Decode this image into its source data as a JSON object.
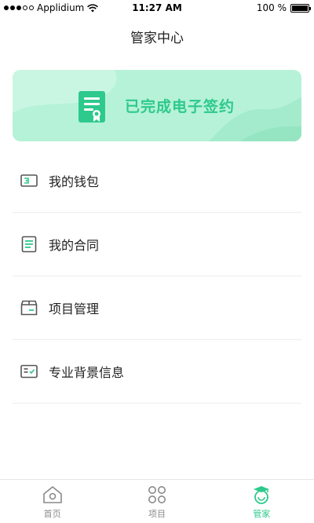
{
  "status_bar": {
    "carrier": "Applidium",
    "time": "11:27 AM",
    "battery_text": "100 %",
    "signal_icon": "signal-dots-icon",
    "wifi_icon": "wifi-icon",
    "battery_icon": "battery-icon"
  },
  "header": {
    "title": "管家中心"
  },
  "banner": {
    "text": "已完成电子签约",
    "icon": "certificate-icon",
    "background_color": "#b6f2d8",
    "accent_color": "#2ec98c"
  },
  "menu": {
    "items": [
      {
        "label": "我的钱包",
        "icon": "wallet-icon"
      },
      {
        "label": "我的合同",
        "icon": "contract-icon"
      },
      {
        "label": "项目管理",
        "icon": "project-box-icon"
      },
      {
        "label": "专业背景信息",
        "icon": "profile-card-icon"
      }
    ]
  },
  "tabbar": {
    "tabs": [
      {
        "label": "首页",
        "icon": "home-icon",
        "active": false
      },
      {
        "label": "项目",
        "icon": "grid-circles-icon",
        "active": false
      },
      {
        "label": "管家",
        "icon": "butler-cap-icon",
        "active": true
      }
    ],
    "active_color": "#2ec98c",
    "inactive_color": "#8a8a8a"
  }
}
